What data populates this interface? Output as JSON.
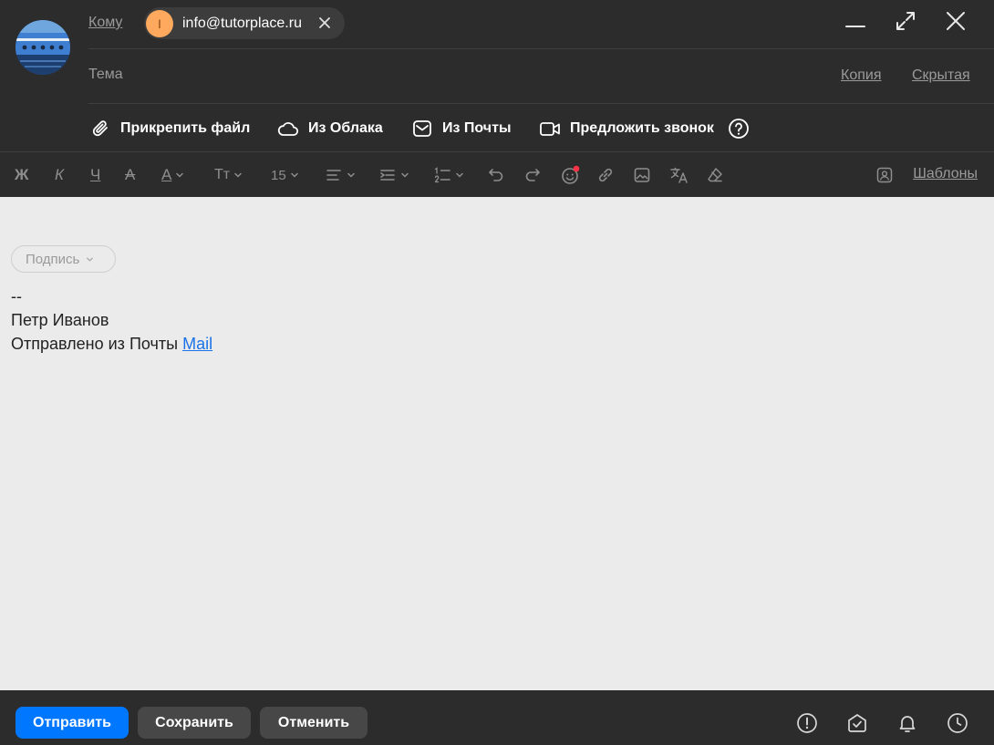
{
  "header": {
    "to_label": "Кому",
    "recipient": {
      "initial": "I",
      "email": "info@tutorplace.ru"
    },
    "subject_label": "Тема",
    "cc_label": "Копия",
    "bcc_label": "Скрытая"
  },
  "attach": {
    "file": "Прикрепить файл",
    "cloud": "Из Облака",
    "mail": "Из Почты",
    "call": "Предложить звонок"
  },
  "toolbar": {
    "bold": "Ж",
    "italic": "К",
    "underline": "Ч",
    "strike": "А",
    "text_color": "А",
    "font": "Тт",
    "font_size": "15",
    "templates": "Шаблоны"
  },
  "body": {
    "signature_chip": "Подпись",
    "sig_dash": "--",
    "sig_name": "Петр Иванов",
    "sig_sent": "Отправлено из Почты",
    "sig_link": "Mail"
  },
  "footer": {
    "send": "Отправить",
    "save": "Сохранить",
    "cancel": "Отменить"
  },
  "colors": {
    "accent": "#0077ff",
    "dark_bg": "#2c2c2c",
    "body_bg": "#ebebeb",
    "recipient_avatar": "#ffa95e",
    "emoji_dot": "#ff3347",
    "link": "#1a73e8"
  }
}
